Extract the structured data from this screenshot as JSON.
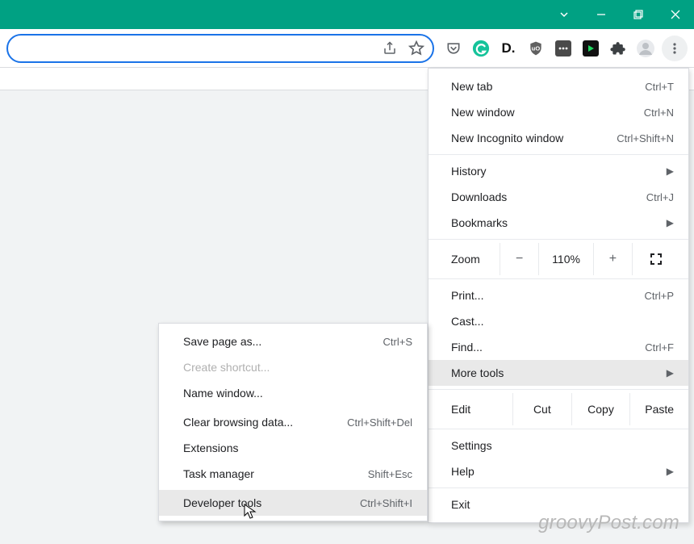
{
  "window": {
    "chevron": "⌄",
    "min": "—",
    "max": "☐",
    "close": "✕"
  },
  "menu": {
    "newTab": {
      "label": "New tab",
      "shortcut": "Ctrl+T"
    },
    "newWindow": {
      "label": "New window",
      "shortcut": "Ctrl+N"
    },
    "incognito": {
      "label": "New Incognito window",
      "shortcut": "Ctrl+Shift+N"
    },
    "history": {
      "label": "History"
    },
    "downloads": {
      "label": "Downloads",
      "shortcut": "Ctrl+J"
    },
    "bookmarks": {
      "label": "Bookmarks"
    },
    "zoom": {
      "label": "Zoom",
      "minus": "−",
      "pct": "110%",
      "plus": "+"
    },
    "print": {
      "label": "Print...",
      "shortcut": "Ctrl+P"
    },
    "cast": {
      "label": "Cast..."
    },
    "find": {
      "label": "Find...",
      "shortcut": "Ctrl+F"
    },
    "moreTools": {
      "label": "More tools"
    },
    "edit": {
      "label": "Edit",
      "cut": "Cut",
      "copy": "Copy",
      "paste": "Paste"
    },
    "settings": {
      "label": "Settings"
    },
    "help": {
      "label": "Help"
    },
    "exit": {
      "label": "Exit"
    }
  },
  "submenu": {
    "savePage": {
      "label": "Save page as...",
      "shortcut": "Ctrl+S"
    },
    "createShortcut": {
      "label": "Create shortcut..."
    },
    "nameWindow": {
      "label": "Name window..."
    },
    "clearBrowsing": {
      "label": "Clear browsing data...",
      "shortcut": "Ctrl+Shift+Del"
    },
    "extensions": {
      "label": "Extensions"
    },
    "taskManager": {
      "label": "Task manager",
      "shortcut": "Shift+Esc"
    },
    "devTools": {
      "label": "Developer tools",
      "shortcut": "Ctrl+Shift+I"
    }
  },
  "watermark": "groovyPost.com"
}
